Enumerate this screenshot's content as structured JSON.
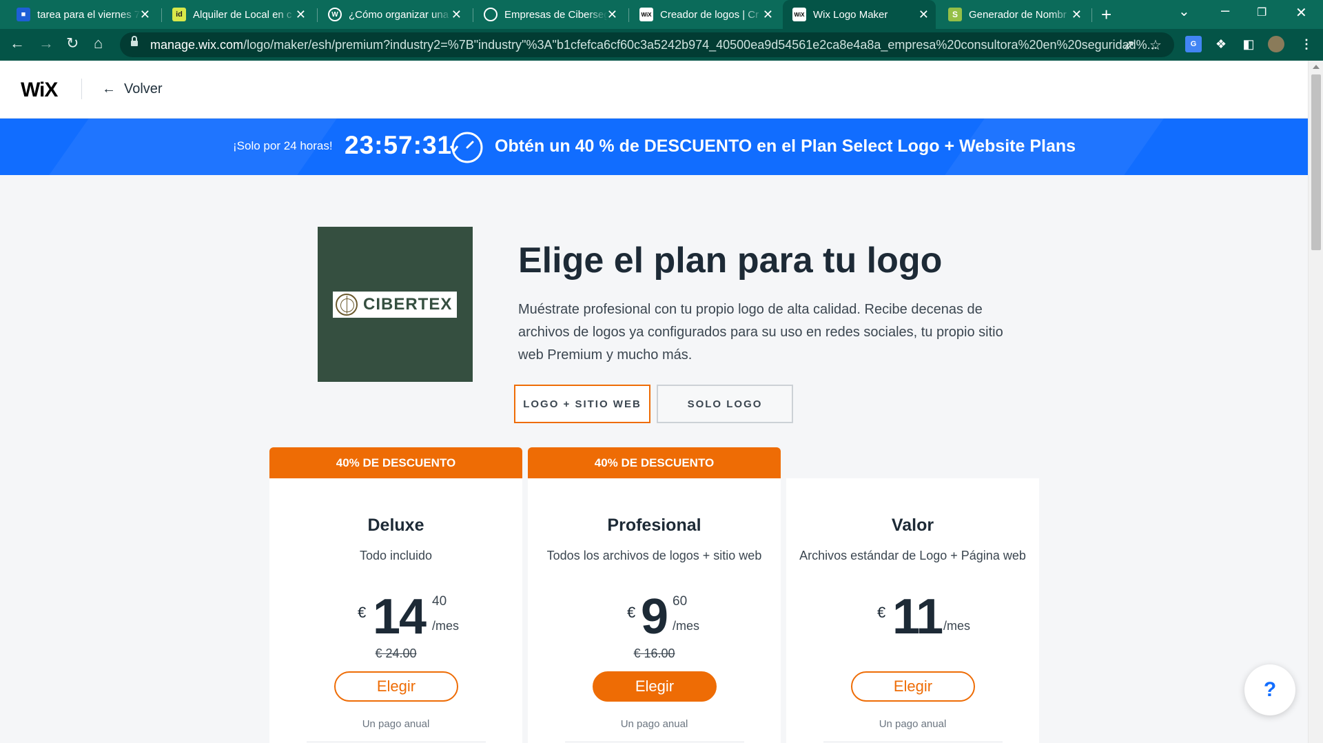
{
  "browser": {
    "tabs": [
      {
        "title": "tarea para el viernes 7",
        "icon": "google-classroom-icon",
        "icon_color": "#1e5fd6"
      },
      {
        "title": "Alquiler de Local en c",
        "icon": "idealista-icon",
        "icon_color": "#d8e84a"
      },
      {
        "title": "¿Cómo organizar una",
        "icon": "wordpress-icon",
        "icon_color": "#ffffff"
      },
      {
        "title": "Empresas de Ciberseg",
        "icon": "globe-icon",
        "icon_color": "#ffffff"
      },
      {
        "title": "Creador de logos | Cr",
        "icon": "wix-icon",
        "icon_color": "#ffffff"
      },
      {
        "title": "Wix Logo Maker",
        "icon": "wix-icon",
        "icon_color": "#ffffff"
      },
      {
        "title": "Generador de Nombr",
        "icon": "shopify-icon",
        "icon_color": "#95bf47"
      }
    ],
    "active_tab": 5,
    "url_host": "manage.wix.com",
    "url_path": "/logo/maker/esh/premium?industry2=%7B\"industry\"%3A\"b1cfefca6cf60c3a5242b974_40500ea9d54561e2ca8e4a8a_empresa%20consultora%20en%20seguridad%..."
  },
  "header": {
    "logo": "WiX",
    "back_label": "Volver"
  },
  "promo": {
    "small": "¡Solo por 24 horas!",
    "timer": "23:57:31",
    "text": "Obtén un 40 % de DESCUENTO en el Plan Select Logo + Website Plans",
    "bg_color": "#116dff"
  },
  "hero": {
    "logo_text": "CIBERTEX",
    "title": "Elige el plan para tu logo",
    "description": "Muéstrate profesional con tu propio logo de alta calidad. Recibe decenas de archivos de logos ya configurados para su uso en redes sociales, tu propio sitio web Premium y mucho más.",
    "toggle": [
      "LOGO + SITIO WEB",
      "SOLO LOGO"
    ]
  },
  "plans": [
    {
      "ribbon": "40% DE DESCUENTO",
      "name": "Deluxe",
      "subtitle": "Todo incluido",
      "currency": "€",
      "price_int": "14",
      "price_dec": "40",
      "period": "/mes",
      "old_price": "€ 24.00",
      "cta": "Elegir",
      "billing": "Un pago anual"
    },
    {
      "ribbon": "40% DE DESCUENTO",
      "name": "Profesional",
      "subtitle": "Todos los archivos de logos + sitio web",
      "currency": "€",
      "price_int": "9",
      "price_dec": "60",
      "period": "/mes",
      "old_price": "€ 16.00",
      "cta": "Elegir",
      "billing": "Un pago anual"
    },
    {
      "name": "Valor",
      "subtitle": "Archivos estándar de Logo + Página web",
      "currency": "€",
      "price_int": "11",
      "period": "/mes",
      "cta": "Elegir",
      "billing": "Un pago anual"
    }
  ],
  "help": "?",
  "colors": {
    "accent": "#ee6c05",
    "brand": "#116dff",
    "text": "#1d2a36"
  }
}
